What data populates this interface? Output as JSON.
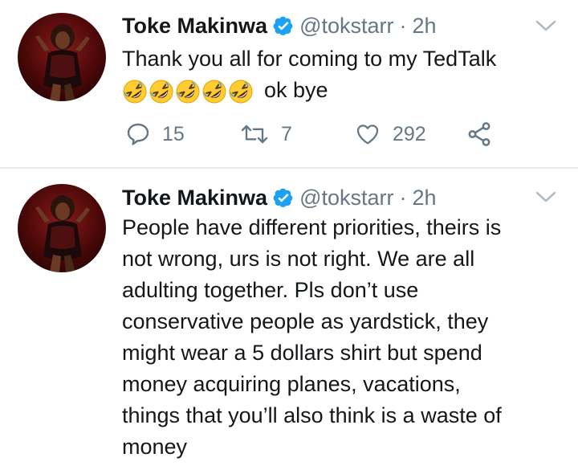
{
  "colors": {
    "text_primary": "#14171a",
    "text_secondary": "#657786",
    "verified_blue": "#1da1f2",
    "divider": "#e6ecf0"
  },
  "icons": [
    "verified-badge-icon",
    "caret-down-icon",
    "reply-icon",
    "retweet-icon",
    "like-icon",
    "share-icon",
    "rolling-on-floor-laughing-emoji"
  ],
  "tweets": [
    {
      "display_name": "Toke Makinwa",
      "handle": "@tokstarr",
      "separator": "·",
      "time": "2h",
      "text_lines": [
        "Thank you all for coming to my TedTalk"
      ],
      "emoji_count": 5,
      "text_after_emoji": "ok bye",
      "actions": {
        "replies": "15",
        "retweets": "7",
        "likes": "292"
      }
    },
    {
      "display_name": "Toke Makinwa",
      "handle": "@tokstarr",
      "separator": "·",
      "time": "2h",
      "text_lines": [
        "People have different priorities, theirs is",
        "not wrong, urs is not right. We are all",
        "adulting together. Pls don’t use",
        "conservative people as yardstick, they",
        "might wear a 5 dollars shirt but spend",
        "money acquiring planes, vacations,",
        "things that you’ll also think is a waste of",
        "money"
      ]
    }
  ]
}
